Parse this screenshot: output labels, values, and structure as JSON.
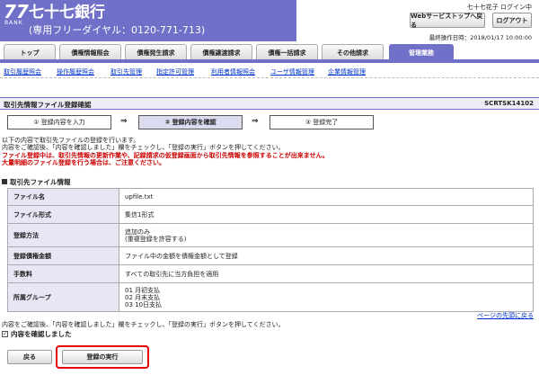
{
  "header": {
    "logo_number": "77",
    "logo_bank": "BANK",
    "bank_name": "七十七銀行",
    "free_dial": "(専用フリーダイヤル：0120-771-713)",
    "user_status": "七十七花子 ログイン中",
    "web_top_button": "Webサービストップへ戻る",
    "logout_button": "ログアウト",
    "last_operation": "最終操作日時：2018/01/17 10:00:00"
  },
  "tabs": [
    {
      "label": "トップ"
    },
    {
      "label": "債権情報照会"
    },
    {
      "label": "債権発生請求"
    },
    {
      "label": "債権譲渡請求"
    },
    {
      "label": "債権一括請求"
    },
    {
      "label": "その他請求"
    },
    {
      "label": "管理業務"
    }
  ],
  "subnav": [
    {
      "label": "取引履歴照会"
    },
    {
      "label": "操作履歴照会"
    },
    {
      "label": "取引先管理"
    },
    {
      "label": "指定許可管理"
    },
    {
      "label": "利用者情報照会"
    },
    {
      "label": "ユーザ情報管理"
    },
    {
      "label": "企業情報管理"
    }
  ],
  "title": {
    "text": "取引先情報ファイル登録確認",
    "screen_id": "SCRTSK14102"
  },
  "steps": [
    {
      "label": "① 登録内容を入力"
    },
    {
      "label": "② 登録内容を確認"
    },
    {
      "label": "③ 登録完了"
    }
  ],
  "arrow": "⇒",
  "messages": {
    "line1": "以下の内容で取引先ファイルの登録を行います。",
    "line2": "内容をご確認後、「内容を確認しました」欄をチェックし、「登録の実行」ボタンを押してください。",
    "warn1": "ファイル登録中は、取引先情報の更新作業や、記録請求の仮登録画面から取引先情報を参照することが出来ません。",
    "warn2": "大量明細のファイル登録を行う場合は、ご注意ください。"
  },
  "section_title": "取引先ファイル情報",
  "info_rows": [
    {
      "label": "ファイル名",
      "value": "upfile.txt"
    },
    {
      "label": "ファイル形式",
      "value": "集信1形式"
    },
    {
      "label": "登録方法",
      "value": "追加のみ\n(重複登録を許容する)"
    },
    {
      "label": "登録債権金額",
      "value": "ファイル中の金額を債権金額として登録"
    },
    {
      "label": "手数料",
      "value": "すべての取引先に当方負担を適用"
    },
    {
      "label": "所属グループ",
      "value": "01 月初支払\n02 月末支払\n03 10日支払"
    }
  ],
  "page_top_link": "ページの先頭に戻る",
  "confirm": {
    "message": "内容をご確認後、「内容を確認しました」欄をチェックし、「登録の実行」ボタンを押してください。",
    "checkbox_label": "内容を確認しました",
    "checked": true
  },
  "buttons": {
    "back": "戻る",
    "execute": "登録の実行"
  },
  "colors": {
    "brand": "#7070c8",
    "link": "#0033cc",
    "warning": "#cc0000",
    "highlight": "#e60000"
  }
}
